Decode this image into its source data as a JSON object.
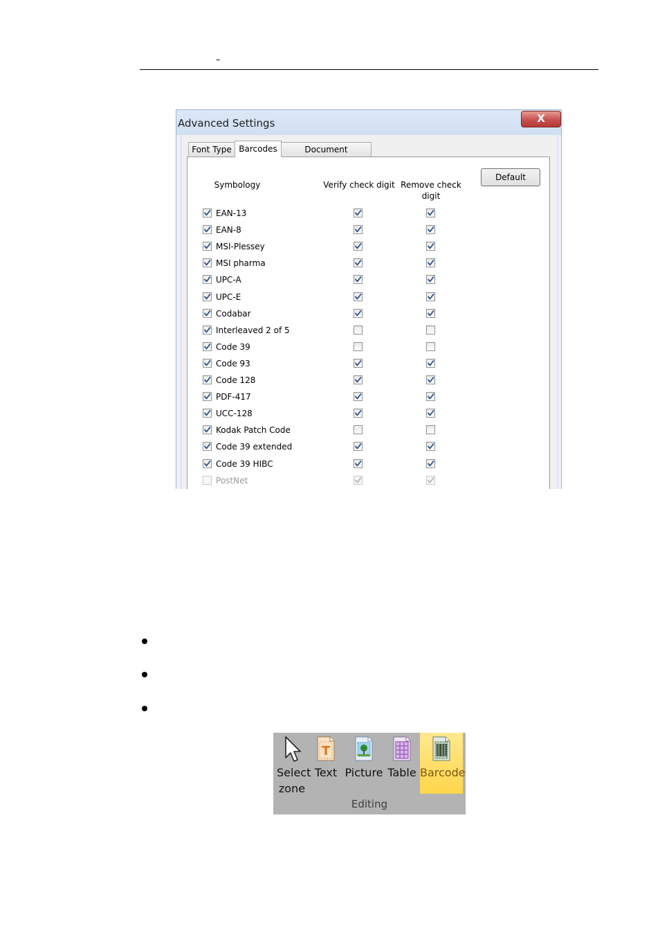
{
  "page": {
    "header_mark": "–"
  },
  "dialog": {
    "title": "Advanced Settings",
    "close_label": "X",
    "tabs": [
      {
        "label": "Font Type",
        "active": false
      },
      {
        "label": "Barcodes",
        "active": true
      },
      {
        "label": "Document Processing",
        "active": false
      }
    ],
    "default_button": "Default",
    "columns": {
      "symbology": "Symbology",
      "verify": "Verify check digit",
      "remove": "Remove check digit"
    },
    "rows": [
      {
        "name": "EAN-13",
        "enabled": true,
        "verify": true,
        "remove": true,
        "disabled": false
      },
      {
        "name": "EAN-8",
        "enabled": true,
        "verify": true,
        "remove": true,
        "disabled": false
      },
      {
        "name": "MSI-Plessey",
        "enabled": true,
        "verify": true,
        "remove": true,
        "disabled": false
      },
      {
        "name": "MSI pharma",
        "enabled": true,
        "verify": true,
        "remove": true,
        "disabled": false
      },
      {
        "name": "UPC-A",
        "enabled": true,
        "verify": true,
        "remove": true,
        "disabled": false
      },
      {
        "name": "UPC-E",
        "enabled": true,
        "verify": true,
        "remove": true,
        "disabled": false
      },
      {
        "name": "Codabar",
        "enabled": true,
        "verify": true,
        "remove": true,
        "disabled": false
      },
      {
        "name": "Interleaved 2 of 5",
        "enabled": true,
        "verify": false,
        "remove": false,
        "disabled": false
      },
      {
        "name": "Code 39",
        "enabled": true,
        "verify": false,
        "remove": false,
        "disabled": false
      },
      {
        "name": "Code 93",
        "enabled": true,
        "verify": true,
        "remove": true,
        "disabled": false
      },
      {
        "name": "Code 128",
        "enabled": true,
        "verify": true,
        "remove": true,
        "disabled": false
      },
      {
        "name": "PDF-417",
        "enabled": true,
        "verify": true,
        "remove": true,
        "disabled": false
      },
      {
        "name": "UCC-128",
        "enabled": true,
        "verify": true,
        "remove": true,
        "disabled": false
      },
      {
        "name": "Kodak Patch Code",
        "enabled": true,
        "verify": false,
        "remove": false,
        "disabled": false
      },
      {
        "name": "Code 39 extended",
        "enabled": true,
        "verify": true,
        "remove": true,
        "disabled": false
      },
      {
        "name": "Code 39 HIBC",
        "enabled": true,
        "verify": true,
        "remove": true,
        "disabled": false
      },
      {
        "name": "PostNet",
        "enabled": false,
        "verify": true,
        "remove": true,
        "disabled": true
      }
    ]
  },
  "ribbon": {
    "group_label": "Editing",
    "buttons": [
      {
        "label": "Select zone",
        "icon": "cursor-arrow-icon",
        "active": false
      },
      {
        "label": "Text",
        "icon": "text-zone-icon",
        "active": false
      },
      {
        "label": "Picture",
        "icon": "picture-zone-icon",
        "active": false
      },
      {
        "label": "Table",
        "icon": "table-zone-icon",
        "active": false
      },
      {
        "label": "Barcode",
        "icon": "barcode-zone-icon",
        "active": true
      }
    ],
    "colors": {
      "background": "#b3b3b3",
      "active": "#ffd54a"
    }
  }
}
